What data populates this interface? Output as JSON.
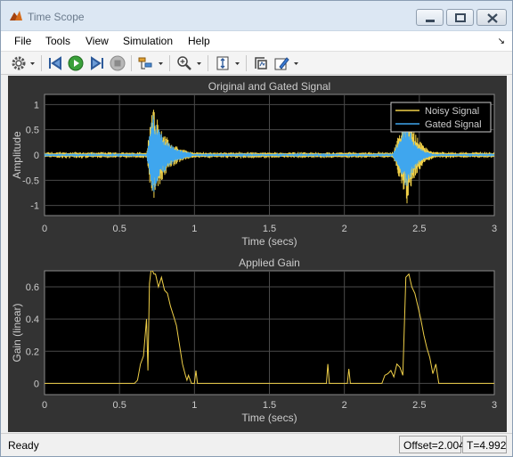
{
  "window": {
    "title": "Time Scope"
  },
  "menu": [
    "File",
    "Tools",
    "View",
    "Simulation",
    "Help"
  ],
  "toolbar": {
    "icons": [
      "gear-icon",
      "step-back-icon",
      "run-icon",
      "step-forward-icon",
      "stop-icon",
      "highlight-icon",
      "zoom-icon",
      "scale-axes-icon",
      "signal-select-icon",
      "style-icon"
    ]
  },
  "status": {
    "ready": "Ready",
    "offset": "Offset=2.004",
    "time": "T=4.992"
  },
  "colors": {
    "noisy": "#f0d048",
    "gated": "#3fa6ee",
    "axes_bg": "#000000",
    "panel_bg": "#333333",
    "text": "#cccccc",
    "grid": "#4a4a4a"
  },
  "chart_data": [
    {
      "type": "line",
      "title": "Original and Gated Signal",
      "xlabel": "Time (secs)",
      "ylabel": "Amplitude",
      "xlim": [
        0,
        3
      ],
      "ylim": [
        -1.2,
        1.2
      ],
      "xticks": [
        "0",
        "0.5",
        "1",
        "1.5",
        "2",
        "2.5",
        "3"
      ],
      "yticks": [
        "1",
        "0.5",
        "0",
        "-0.5",
        "-1"
      ],
      "grid": true,
      "legend": "top-right",
      "series": [
        {
          "name": "Noisy Signal",
          "bursts": [
            {
              "start": 0.68,
              "peak": 0.72,
              "end": 1.0,
              "amp": 1.0
            },
            {
              "start": 2.32,
              "peak": 2.42,
              "end": 2.62,
              "amp": 1.0
            }
          ],
          "noise": 0.06
        },
        {
          "name": "Gated Signal",
          "bursts": [
            {
              "start": 0.68,
              "peak": 0.72,
              "end": 0.98,
              "amp": 0.85
            },
            {
              "start": 2.32,
              "peak": 2.42,
              "end": 2.58,
              "amp": 0.7
            }
          ],
          "noise": 0.02
        }
      ]
    },
    {
      "type": "line",
      "title": "Applied Gain",
      "xlabel": "Time (secs)",
      "ylabel": "Gain (linear)",
      "xlim": [
        0,
        3
      ],
      "ylim": [
        -0.07,
        0.7
      ],
      "xticks": [
        "0",
        "0.5",
        "1",
        "1.5",
        "2",
        "2.5",
        "3"
      ],
      "yticks": [
        "0.6",
        "0.4",
        "0.2",
        "0"
      ],
      "grid": true,
      "series": [
        {
          "name": "",
          "x": [
            0,
            0.6,
            0.62,
            0.64,
            0.66,
            0.68,
            0.69,
            0.7,
            0.71,
            0.72,
            0.73,
            0.74,
            0.76,
            0.78,
            0.8,
            0.82,
            0.84,
            0.86,
            0.88,
            0.9,
            0.92,
            0.94,
            0.95,
            0.96,
            0.98,
            1.0,
            1.01,
            1.02,
            1.03,
            1.05,
            1.88,
            1.89,
            1.9,
            1.91,
            1.92,
            2.02,
            2.03,
            2.04,
            2.05,
            2.06,
            2.25,
            2.27,
            2.29,
            2.31,
            2.33,
            2.35,
            2.37,
            2.39,
            2.41,
            2.43,
            2.45,
            2.47,
            2.49,
            2.51,
            2.53,
            2.55,
            2.57,
            2.59,
            2.61,
            2.63,
            2.65,
            3.0
          ],
          "y": [
            0,
            0,
            0.02,
            0.12,
            0.17,
            0.4,
            0.08,
            0.62,
            0.7,
            0.7,
            0.68,
            0.68,
            0.6,
            0.66,
            0.58,
            0.56,
            0.48,
            0.42,
            0.36,
            0.24,
            0.12,
            0.05,
            0.02,
            0.05,
            0.0,
            0.0,
            0.08,
            0.0,
            0.0,
            0.0,
            0.0,
            0.12,
            0.0,
            0.0,
            0.0,
            0.0,
            0.09,
            0.0,
            0.0,
            0.0,
            0.0,
            0.05,
            0.06,
            0.08,
            0.04,
            0.12,
            0.1,
            0.05,
            0.66,
            0.68,
            0.6,
            0.56,
            0.48,
            0.4,
            0.3,
            0.22,
            0.16,
            0.06,
            0.12,
            0.0,
            0.0,
            0.0
          ]
        }
      ]
    }
  ]
}
